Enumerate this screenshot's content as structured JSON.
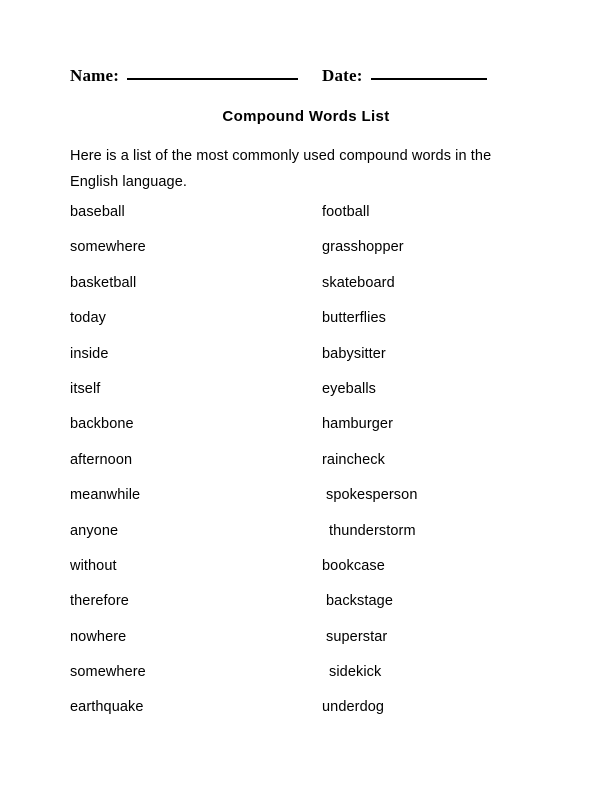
{
  "header": {
    "name_label": "Name:",
    "date_label": "Date:",
    "name_value": "",
    "date_value": ""
  },
  "title": "Compound Words List",
  "intro": "Here is a list of the most commonly used compound words in the English language.",
  "word_list": {
    "left_column": [
      "baseball",
      "somewhere",
      "basketball",
      "today",
      "inside",
      "itself",
      "backbone",
      "afternoon",
      "meanwhile",
      "anyone",
      "without",
      "therefore",
      "nowhere",
      "somewhere",
      "earthquake"
    ],
    "right_column": [
      "football",
      "grasshopper",
      "skateboard",
      "butterflies",
      "babysitter",
      "eyeballs",
      "hamburger",
      "raincheck",
      "spokesperson",
      "thunderstorm",
      "bookcase",
      "backstage",
      "superstar",
      "sidekick",
      "underdog"
    ]
  }
}
